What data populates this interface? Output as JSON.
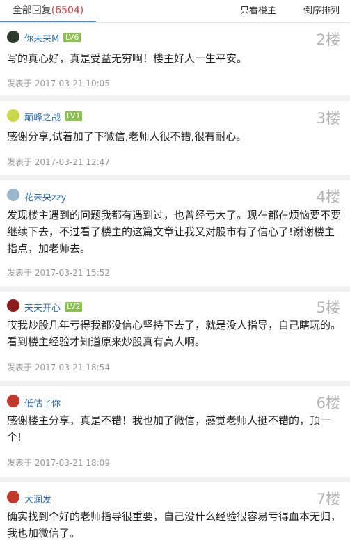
{
  "tabs": {
    "all_label": "全部回复",
    "all_count": "(6504)",
    "owner_only": "只看楼主",
    "reverse": "倒序排列"
  },
  "posts": [
    {
      "user": "你未来M",
      "level": "LV6",
      "floor": "2楼",
      "content": "写的真心好，真是受益无穷啊！楼主好人一生平安。",
      "time": "发表于 2017-03-21 10:05",
      "avatar_color": "#2e3a2e"
    },
    {
      "user": "巅峰之战",
      "level": "LV1",
      "floor": "3楼",
      "content": "感谢分享,试着加了下微信,老师人很不错,很有耐心。",
      "time": "发表于 2017-03-21 12:47",
      "avatar_color": "#c8d84a"
    },
    {
      "user": "花未央zzy",
      "level": "",
      "floor": "4楼",
      "content": "发现楼主遇到的问题我都有遇到过，也曾经亏大了。现在都在烦恼要不要继续下去，不过看了楼主的这篇文章让我又对股市有了信心了!谢谢楼主指点，加老师去。",
      "time": "发表于 2017-03-21 15:52",
      "avatar_color": "#9bb7cc"
    },
    {
      "user": "天天开心",
      "level": "LV2",
      "floor": "5楼",
      "content": "哎我炒股几年亏得我都没信心坚持下去了，就是没人指导，自己瞎玩的。看到楼主经验才知道原来炒股真有高人啊。",
      "time": "发表于 2017-03-21 18:54",
      "avatar_color": "#8a1c1c"
    },
    {
      "user": "低估了你",
      "level": "",
      "floor": "6楼",
      "content": "感谢楼主分享，真是不错！我也加了微信，感觉老师人挺不错的，顶一个!",
      "time": "发表于 2017-03-21 18:09",
      "avatar_color": "#c0392b"
    },
    {
      "user": "大润发",
      "level": "",
      "floor": "7楼",
      "content": "确实找到个好的老师指导很重要，自己没什么经验很容易亏得血本无归，我也加微信了。",
      "time": "",
      "avatar_color": "#c0392b"
    }
  ]
}
